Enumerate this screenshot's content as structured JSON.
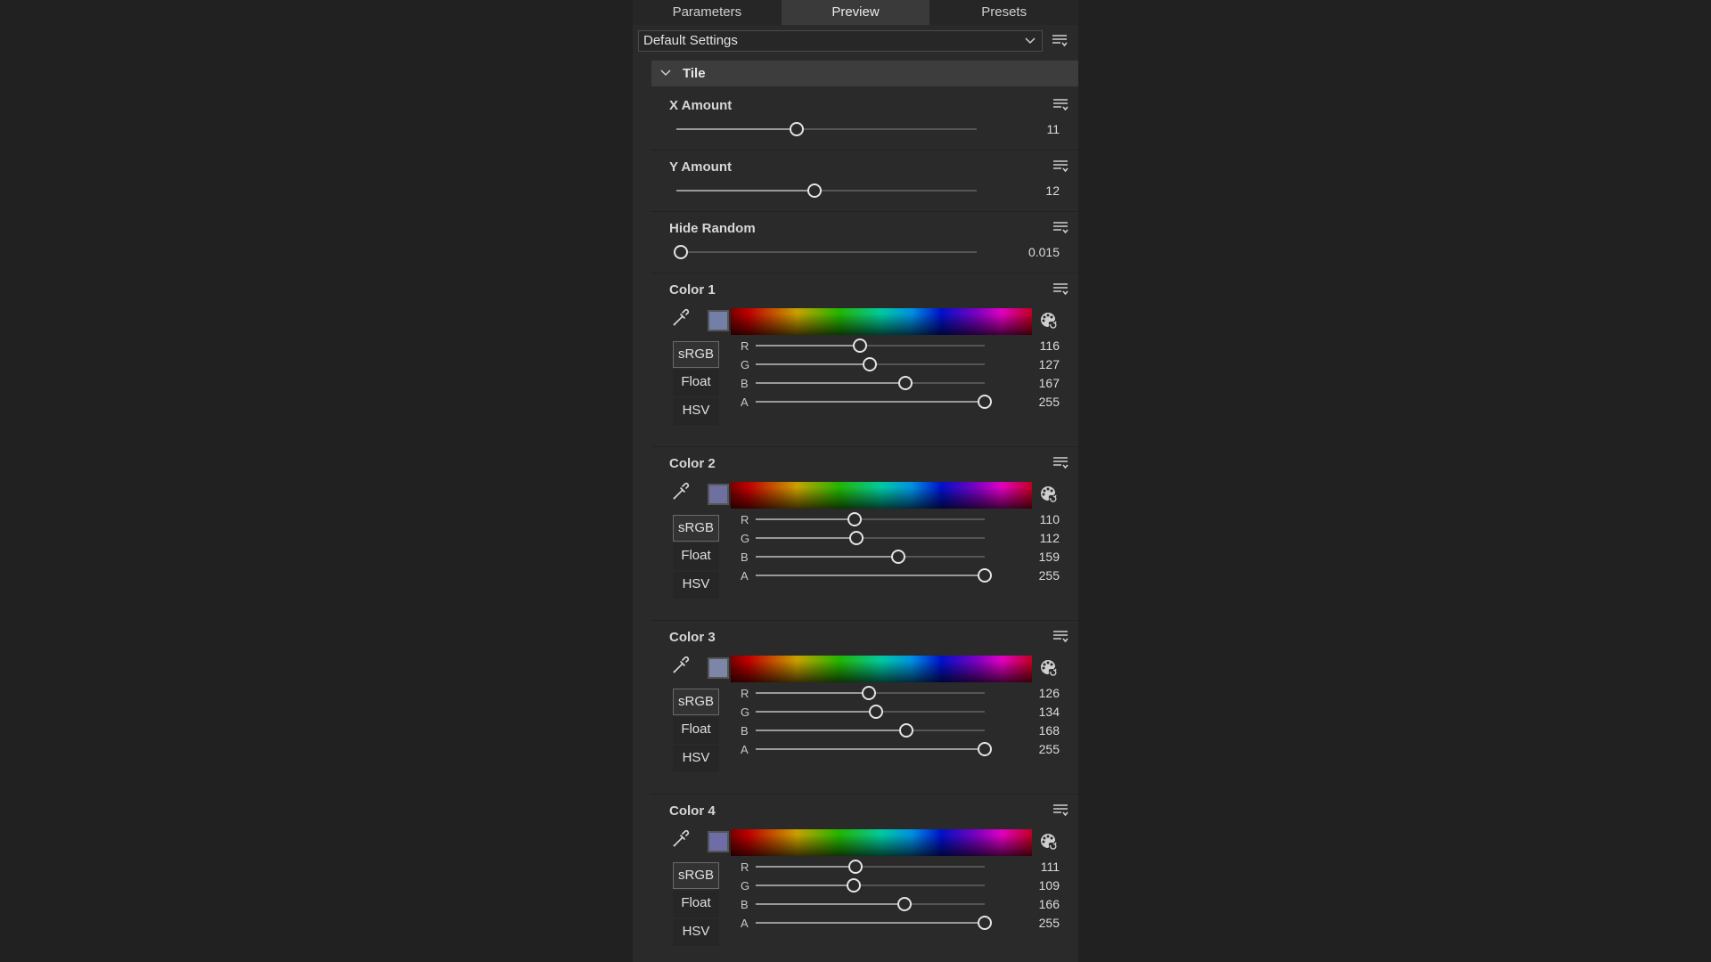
{
  "tabs": [
    {
      "label": "Parameters",
      "active": false
    },
    {
      "label": "Preview",
      "active": true
    },
    {
      "label": "Presets",
      "active": false
    }
  ],
  "preset": {
    "value": "Default Settings"
  },
  "group": {
    "title": "Tile",
    "expanded": true
  },
  "params": [
    {
      "label": "X Amount",
      "value": "11",
      "fraction": 0.4
    },
    {
      "label": "Y Amount",
      "value": "12",
      "fraction": 0.46
    },
    {
      "label": "Hide Random",
      "value": "0.015",
      "fraction": 0.015
    }
  ],
  "colors": [
    {
      "label": "Color 1",
      "swatch": "#747fa7",
      "channels": [
        {
          "name": "R",
          "value": "116"
        },
        {
          "name": "G",
          "value": "127"
        },
        {
          "name": "B",
          "value": "167"
        },
        {
          "name": "A",
          "value": "255"
        }
      ]
    },
    {
      "label": "Color 2",
      "swatch": "#6e709f",
      "channels": [
        {
          "name": "R",
          "value": "110"
        },
        {
          "name": "G",
          "value": "112"
        },
        {
          "name": "B",
          "value": "159"
        },
        {
          "name": "A",
          "value": "255"
        }
      ]
    },
    {
      "label": "Color 3",
      "swatch": "#7e86a8",
      "channels": [
        {
          "name": "R",
          "value": "126"
        },
        {
          "name": "G",
          "value": "134"
        },
        {
          "name": "B",
          "value": "168"
        },
        {
          "name": "A",
          "value": "255"
        }
      ]
    },
    {
      "label": "Color 4",
      "swatch": "#6f6da6",
      "channels": [
        {
          "name": "R",
          "value": "111"
        },
        {
          "name": "G",
          "value": "109"
        },
        {
          "name": "B",
          "value": "166"
        },
        {
          "name": "A",
          "value": "255"
        }
      ]
    }
  ],
  "color_modes": [
    "sRGB",
    "Float",
    "HSV"
  ],
  "active_color_mode": "sRGB",
  "icons": {
    "menu": "hamburger-menu-icon",
    "dropdown": "chevron-down-icon",
    "collapse": "chevron-down-icon",
    "eyedropper": "eyedropper-icon",
    "color_wheel": "color-wheel-icon"
  }
}
